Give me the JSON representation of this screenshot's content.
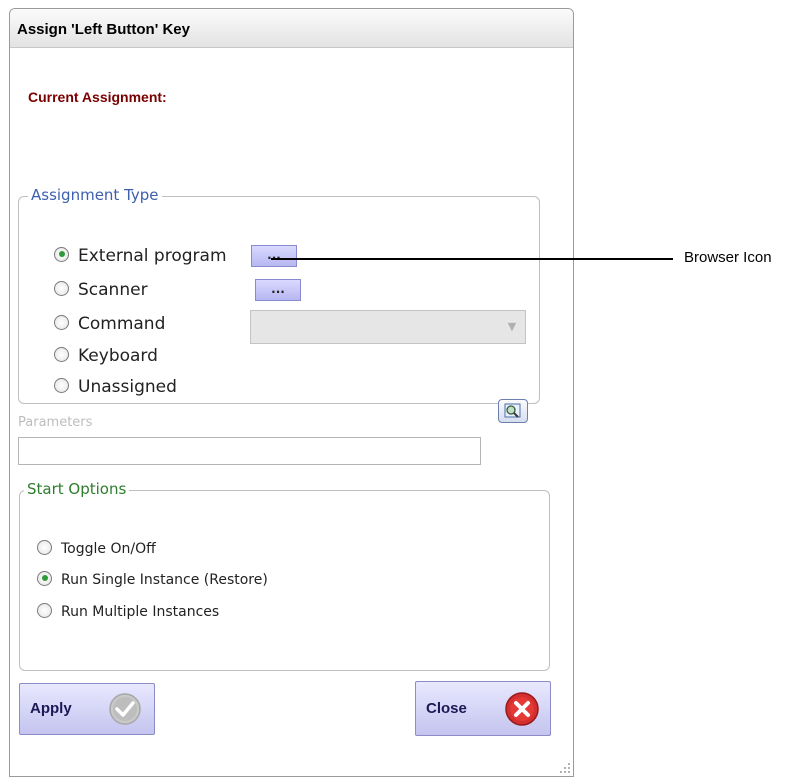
{
  "window": {
    "title": "Assign 'Left Button' Key"
  },
  "current_assignment_label": "Current Assignment:",
  "assignment_type": {
    "legend": "Assignment Type",
    "options": [
      {
        "label": "External program",
        "checked": true
      },
      {
        "label": "Scanner",
        "checked": false
      },
      {
        "label": "Command",
        "checked": false
      },
      {
        "label": "Keyboard",
        "checked": false
      },
      {
        "label": "Unassigned",
        "checked": false
      }
    ],
    "browse_button_label": "...",
    "scanner_button_label": "...",
    "command_select_value": ""
  },
  "parameters": {
    "label": "Parameters",
    "value": ""
  },
  "start_options": {
    "legend": "Start Options",
    "options": [
      {
        "label": "Toggle On/Off",
        "checked": false
      },
      {
        "label": "Run Single Instance (Restore)",
        "checked": true
      },
      {
        "label": "Run Multiple Instances",
        "checked": false
      }
    ]
  },
  "buttons": {
    "apply": "Apply",
    "close": "Close"
  },
  "annotation": {
    "label": "Browser Icon"
  },
  "colors": {
    "accent_blue": "#3d5fae",
    "accent_green": "#2d7d2d",
    "current_assignment": "#7a0000",
    "button_fill": "#c4c4ef"
  },
  "icons": {
    "find_icon": "magnifier-icon",
    "apply_icon": "check-icon",
    "close_icon": "close-x-icon"
  }
}
